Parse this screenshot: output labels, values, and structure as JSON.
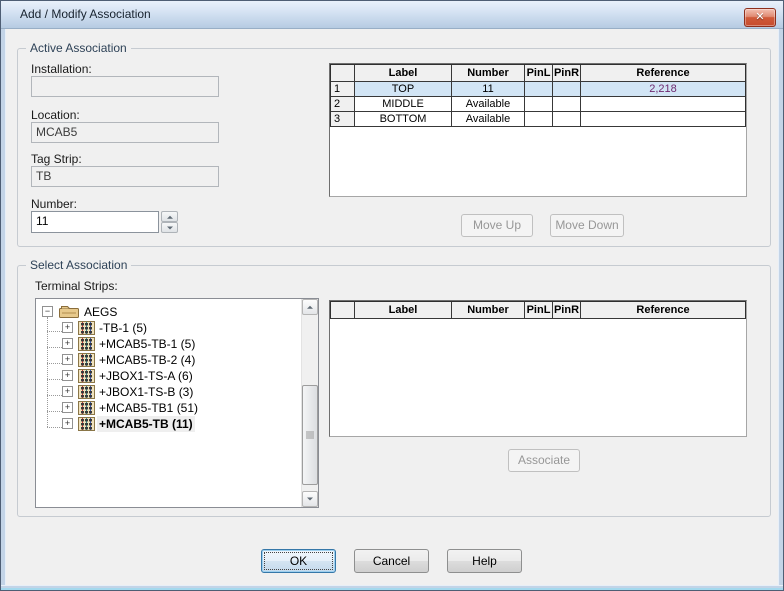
{
  "window": {
    "title": "Add / Modify Association"
  },
  "icons": {
    "close_glyph": "✕",
    "tree_collapse_glyph": "−",
    "tree_expand_glyph": "+"
  },
  "active": {
    "group_label": "Active Association",
    "installation_label": "Installation:",
    "installation_value": "",
    "location_label": "Location:",
    "location_value": "MCAB5",
    "tag_strip_label": "Tag Strip:",
    "tag_strip_value": "TB",
    "number_label": "Number:",
    "number_value": "11",
    "move_up": "Move Up",
    "move_down": "Move Down"
  },
  "active_grid": {
    "columns": [
      "",
      "Label",
      "Number",
      "PinL",
      "PinR",
      "Reference"
    ],
    "rows": [
      {
        "num": "1",
        "label": "TOP",
        "number": "11",
        "pinl": "",
        "pinr": "",
        "reference": "2,218"
      },
      {
        "num": "2",
        "label": "MIDDLE",
        "number": "Available",
        "pinl": "",
        "pinr": "",
        "reference": ""
      },
      {
        "num": "3",
        "label": "BOTTOM",
        "number": "Available",
        "pinl": "",
        "pinr": "",
        "reference": ""
      }
    ]
  },
  "select": {
    "group_label": "Select Association",
    "tree_label": "Terminal Strips:",
    "root": "AEGS",
    "items": [
      "-TB-1 (5)",
      "+MCAB5-TB-1 (5)",
      "+MCAB5-TB-2 (4)",
      "+JBOX1-TS-A (6)",
      "+JBOX1-TS-B (3)",
      "+MCAB5-TB1 (51)",
      "+MCAB5-TB (11)"
    ],
    "associate": "Associate"
  },
  "select_grid": {
    "columns": [
      "",
      "Label",
      "Number",
      "PinL",
      "PinR",
      "Reference"
    ]
  },
  "footer": {
    "ok": "OK",
    "cancel": "Cancel",
    "help": "Help"
  },
  "colors": {
    "selected_row": "#d2e5f5",
    "reference_text": "#6f2a70",
    "titlebar_top": "#e9f1fb",
    "titlebar_bottom": "#b6cbe2",
    "close_button": "#c64c2d"
  }
}
